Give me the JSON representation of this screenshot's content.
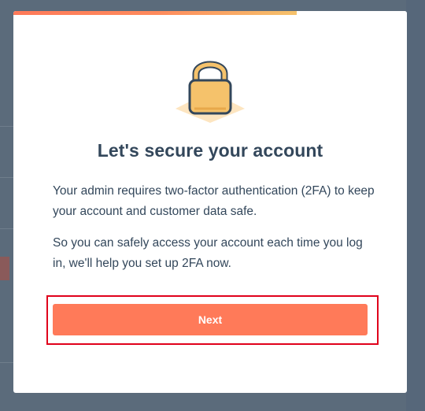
{
  "modal": {
    "progress_fraction": 0.72,
    "illustration_icon": "padlock-icon",
    "title": "Let's secure your account",
    "paragraph1": "Your admin requires two-factor authentication (2FA) to keep your account and customer data safe.",
    "paragraph2": "So you can safely access your account each time you log in, we'll help you set up 2FA now.",
    "next_button_label": "Next"
  },
  "colors": {
    "accent": "#ff7a59",
    "text": "#33475b",
    "highlight": "#e0001b",
    "lock_body": "#f5c26b"
  }
}
